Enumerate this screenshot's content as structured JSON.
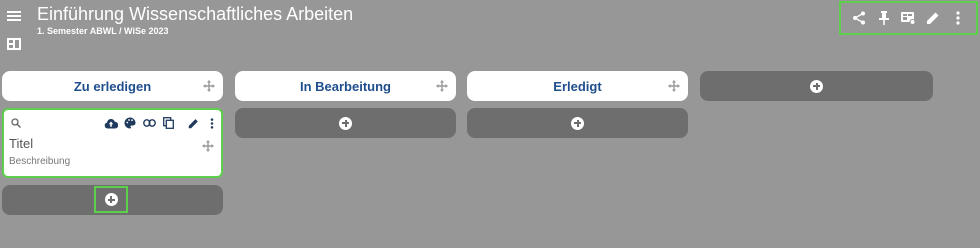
{
  "header": {
    "title": "Einführung Wissenschaftliches Arbeiten",
    "subtitle": "1. Semester ABWL / WiSe 2023"
  },
  "toolbar": {
    "icons": [
      "share-icon",
      "pin-icon",
      "board-view-icon",
      "edit-icon",
      "more-vert-icon"
    ]
  },
  "columns": [
    {
      "label": "Zu erledigen"
    },
    {
      "label": "In Bearbeitung"
    },
    {
      "label": "Erledigt"
    }
  ],
  "card": {
    "title": "Titel",
    "description": "Beschreibung",
    "tools": [
      "cloud-upload-icon",
      "palette-icon",
      "link-icon",
      "copy-icon",
      "edit-icon",
      "more-vert-icon"
    ]
  },
  "colors": {
    "background": "#979797",
    "column_header_text": "#1f4e8c",
    "highlight": "#5cd04a",
    "add_bar": "#6e6e6e"
  }
}
